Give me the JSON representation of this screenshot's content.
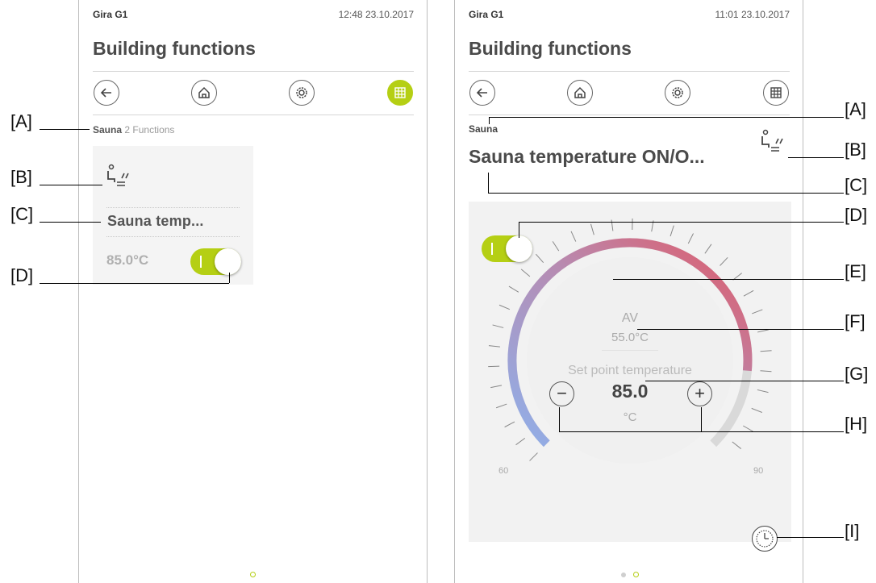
{
  "left": {
    "brand": "Gira G1",
    "clock": "12:48  23.10.2017",
    "title": "Building functions",
    "breadcrumb": {
      "room": "Sauna",
      "count": "2",
      "label": "Functions"
    },
    "tile": {
      "name": "Sauna temp...",
      "value": "85.0°C"
    }
  },
  "right": {
    "brand": "Gira G1",
    "clock": "11:01  23.10.2017",
    "title": "Building functions",
    "room": "Sauna",
    "function_name": "Sauna temperature ON/O...",
    "dial": {
      "av_label": "AV",
      "av_value": "55.0°C",
      "setpoint_label": "Set point temperature",
      "setpoint_value": "85.0",
      "unit": "°C",
      "min_label": "60",
      "max_label": "90",
      "minus": "−",
      "plus": "+"
    }
  },
  "callouts_left": [
    "[A]",
    "[B]",
    "[C]",
    "[D]"
  ],
  "callouts_right": [
    "[A]",
    "[B]",
    "[C]",
    "[D]",
    "[E]",
    "[F]",
    "[G]",
    "[H]",
    "[I]"
  ],
  "colors": {
    "accent": "#b5cf14",
    "dial_cold": "#8fb0ea",
    "dial_hot": "#e05a68"
  },
  "icons": [
    "back-arrow-icon",
    "home-icon",
    "settings-gear-icon",
    "grid-icon",
    "sauna-icon",
    "clock-timer-icon"
  ]
}
